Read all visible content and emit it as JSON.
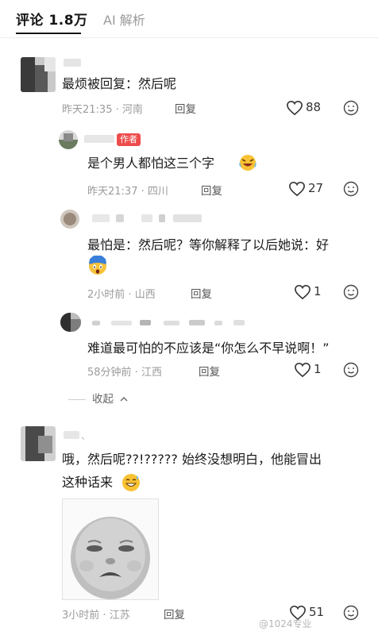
{
  "tabs": {
    "comments": "评论 1.8万",
    "ai": "AI 解析"
  },
  "comments": [
    {
      "text": "最烦被回复：然后呢",
      "time": "昨天21:35",
      "region": "河南",
      "reply": "回复",
      "likes": "88"
    },
    {
      "text": "是个男人都怕这三个字",
      "author_tag": "作者",
      "time": "昨天21:37",
      "region": "四川",
      "reply": "回复",
      "likes": "27"
    },
    {
      "text_line1": "最怕是：然后呢？等你解释了以后她说：好",
      "time": "2小时前",
      "region": "山西",
      "reply": "回复",
      "likes": "1"
    },
    {
      "text": "难道最可怕的不应该是“你怎么不早说啊！”",
      "time": "58分钟前",
      "region": "江西",
      "reply": "回复",
      "likes": "1"
    },
    {
      "text_line1": "哦，然后呢??!????? 始终没想明白，他能冒出",
      "text_line2": "这种话来",
      "time": "3小时前",
      "region": "江苏",
      "reply": "回复",
      "likes": "51"
    }
  ],
  "collapse_label": "收起",
  "watermark": "@1024专业",
  "icons": [
    "heart-outline-icon",
    "smile-face-icon",
    "chevron-up-icon",
    "laughing-crying-emoji",
    "shocked-blue-emoji",
    "grinning-sweat-emoji",
    "crying-baby-sticker"
  ],
  "colors": {
    "author_tag": "#ee4c4c",
    "meta": "#9b9b9b"
  }
}
